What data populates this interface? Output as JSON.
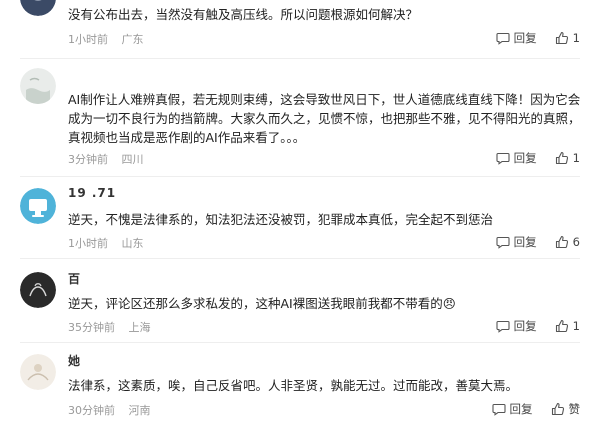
{
  "comments": [
    {
      "username": "",
      "text": "没有公布出去，当然没有触及高压线。所以问题根源如何解决？",
      "time": "1小时前",
      "location": "广东",
      "reply_label": "回复",
      "likes": "1"
    },
    {
      "username": "",
      "text": "AI制作让人难辨真假，若无规则束缚，这会导致世风日下，世人道德底线直线下降！因为它会成为一切不良行为的挡箭牌。大家久而久之，见惯不惊，也把那些不雅，见不得阳光的真照，真视频也当成是恶作剧的AI作品来看了。。。",
      "time": "3分钟前",
      "location": "四川",
      "reply_label": "回复",
      "likes": "1"
    },
    {
      "username": "19    .71",
      "text": "逆天，不愧是法律系的，知法犯法还没被罚，犯罪成本真低，完全起不到惩治",
      "time": "1小时前",
      "location": "山东",
      "reply_label": "回复",
      "likes": "6"
    },
    {
      "username": "百",
      "text": "逆天，评论区还那么多求私发的，这种AI裸图送我眼前我都不带看的😠",
      "time": "35分钟前",
      "location": "上海",
      "reply_label": "回复",
      "likes": "1"
    },
    {
      "username": "她",
      "text": "法律系，这素质，唉，自己反省吧。人非圣贤，孰能无过。过而能改，善莫大焉。",
      "time": "30分钟前",
      "location": "河南",
      "reply_label": "回复",
      "likes": "赞"
    }
  ]
}
